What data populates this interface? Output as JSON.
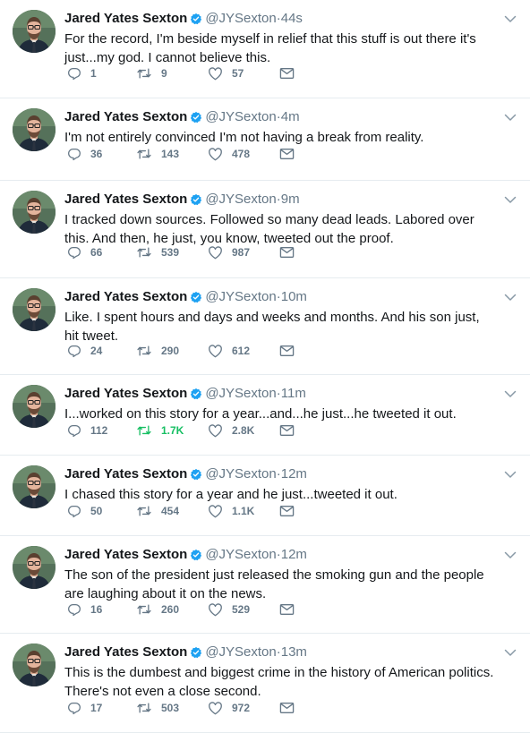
{
  "author": {
    "name": "Jared Yates Sexton",
    "handle": "@JYSexton"
  },
  "separator": "·",
  "colors": {
    "verified": "#1da1f2",
    "retweet_active": "#17bf63",
    "meta_text": "#657786",
    "divider": "#e6ecf0"
  },
  "icons": {
    "reply": "speech-bubble",
    "retweet": "two-arrows-loop",
    "like": "heart-outline",
    "message": "envelope",
    "menu": "chevron-down"
  },
  "tweets": [
    {
      "time": "44s",
      "text": "For the record, I'm beside myself in relief that this stuff is out there it's just...my god. I cannot believe this.",
      "replies": "1",
      "retweets": "9",
      "likes": "57",
      "retweeted": false
    },
    {
      "time": "4m",
      "text": "I'm not entirely convinced I'm not having a break from reality.",
      "replies": "36",
      "retweets": "143",
      "likes": "478",
      "retweeted": false
    },
    {
      "time": "9m",
      "text": "I tracked down sources. Followed so many dead leads. Labored over this. And then, he just, you know, tweeted out the proof.",
      "replies": "66",
      "retweets": "539",
      "likes": "987",
      "retweeted": false
    },
    {
      "time": "10m",
      "text": "Like. I spent hours and days and weeks and months. And his son just, hit tweet.",
      "replies": "24",
      "retweets": "290",
      "likes": "612",
      "retweeted": false
    },
    {
      "time": "11m",
      "text": "I...worked on this story for a year...and...he just...he tweeted it out.",
      "replies": "112",
      "retweets": "1.7K",
      "likes": "2.8K",
      "retweeted": true
    },
    {
      "time": "12m",
      "text": "I chased this story for a year and he just...tweeted it out.",
      "replies": "50",
      "retweets": "454",
      "likes": "1.1K",
      "retweeted": false
    },
    {
      "time": "12m",
      "text": "The son of the president just released the smoking gun and the people are laughing about it on the news.",
      "replies": "16",
      "retweets": "260",
      "likes": "529",
      "retweeted": false
    },
    {
      "time": "13m",
      "text": "This is the dumbest and biggest crime in the history of American politics. There's not even a close second.",
      "replies": "17",
      "retweets": "503",
      "likes": "972",
      "retweeted": false
    }
  ]
}
